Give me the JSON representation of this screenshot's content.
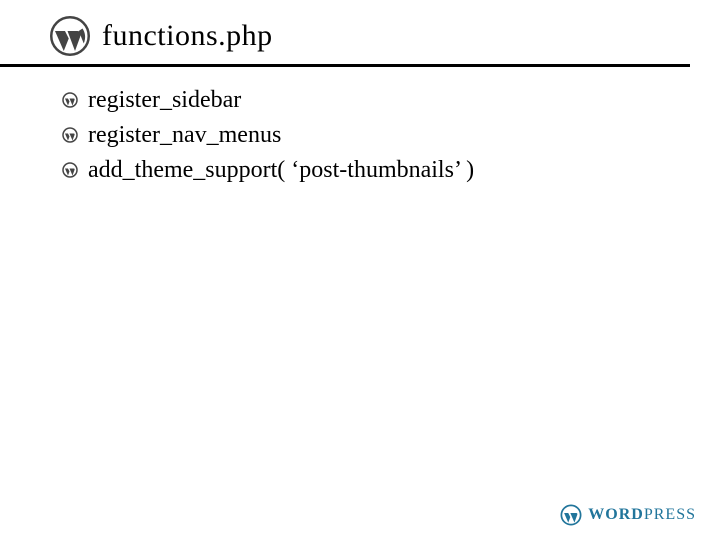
{
  "header": {
    "title": "functions.php"
  },
  "items": [
    "register_sidebar",
    "register_nav_menus",
    "add_theme_support( ‘post-thumbnails’ )"
  ],
  "footer": {
    "brand_word": "Word",
    "brand_press": "Press"
  },
  "colors": {
    "brand": "#21759b",
    "icon": "#444444"
  }
}
